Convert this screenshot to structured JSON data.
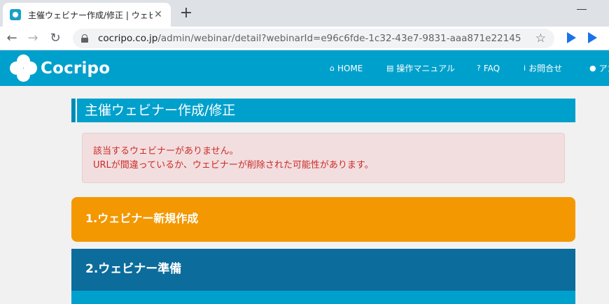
{
  "browser": {
    "tab_title": "主催ウェビナー作成/修正 | ウェビナー",
    "tab_close": "✕",
    "new_tab": "+",
    "url_host": "cocripo.co.jp",
    "url_path": "/admin/webinar/detail?webinarId=e96c6fde-1c32-43e7-9831-aaa871e22145",
    "back": "←",
    "forward": "→",
    "reload": "↻",
    "star": "☆"
  },
  "site": {
    "logo_text": "Cocripo",
    "brand_color": "#00a0cc",
    "nav": [
      {
        "icon": "home-icon",
        "glyph": "⌂",
        "label": "HOME"
      },
      {
        "icon": "document-icon",
        "glyph": "▤",
        "label": "操作マニュアル"
      },
      {
        "icon": "question-icon",
        "glyph": "?",
        "label": "FAQ"
      },
      {
        "icon": "info-icon",
        "glyph": "i",
        "label": "お問合せ"
      },
      {
        "icon": "user-icon",
        "glyph": "●",
        "label": "アカ"
      }
    ]
  },
  "content": {
    "page_title": "主催ウェビナー作成/修正",
    "alert_line1": "該当するウェビナーがありません。",
    "alert_line2": "URLが間違っているか、ウェビナーが削除された可能性があります。",
    "step1": "1.ウェビナー新規作成",
    "step2": "2.ウェビナー準備",
    "step1_color": "#f39800",
    "step2_color": "#0c6c9c"
  }
}
